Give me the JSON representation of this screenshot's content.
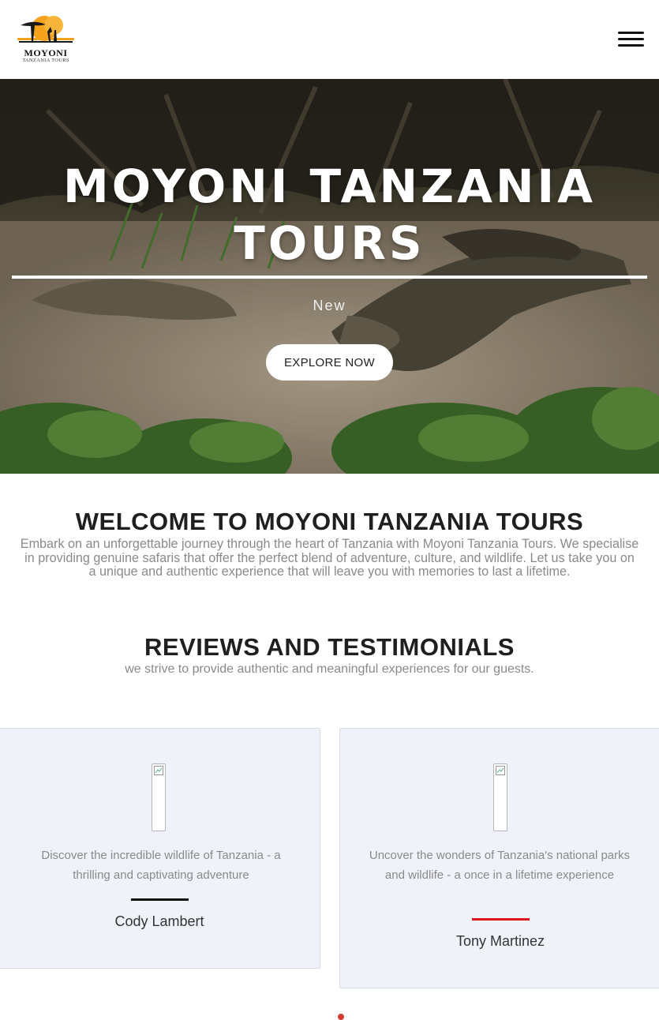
{
  "header": {
    "logo_word": "MOYONI",
    "logo_sub": "TANZANIA TOURS",
    "menu_icon": "hamburger-menu-icon"
  },
  "hero": {
    "title": "MOYONI TANZANIA TOURS",
    "subtitle": "New",
    "button_label": "EXPLORE NOW"
  },
  "welcome": {
    "title": "WELCOME TO MOYONI TANZANIA TOURS",
    "text": "Embark on an unforgettable journey through the heart of Tanzania with Moyoni Tanzania Tours. We specialise in providing genuine safaris that offer the perfect blend of adventure, culture, and wildlife. Let us take you on a unique and authentic experience that will leave you with memories to last a lifetime."
  },
  "reviews": {
    "title": "REVIEWS AND TESTIMONIALS",
    "subtitle": "we strive to provide authentic and meaningful experiences for our guests.",
    "items": [
      {
        "text": "Discover the incredible wildlife of Tanzania - a thrilling and captivating adventure",
        "name": "Cody Lambert",
        "accent": "#111111"
      },
      {
        "text": "Uncover the wonders of Tanzania's national parks and wildlife - a once in a lifetime experience",
        "name": "Tony Martinez",
        "accent": "#e0141c"
      }
    ]
  },
  "colors": {
    "card_bg": "#eff2f8",
    "muted_text": "#8a8a8a",
    "heading": "#1f1f1f"
  }
}
